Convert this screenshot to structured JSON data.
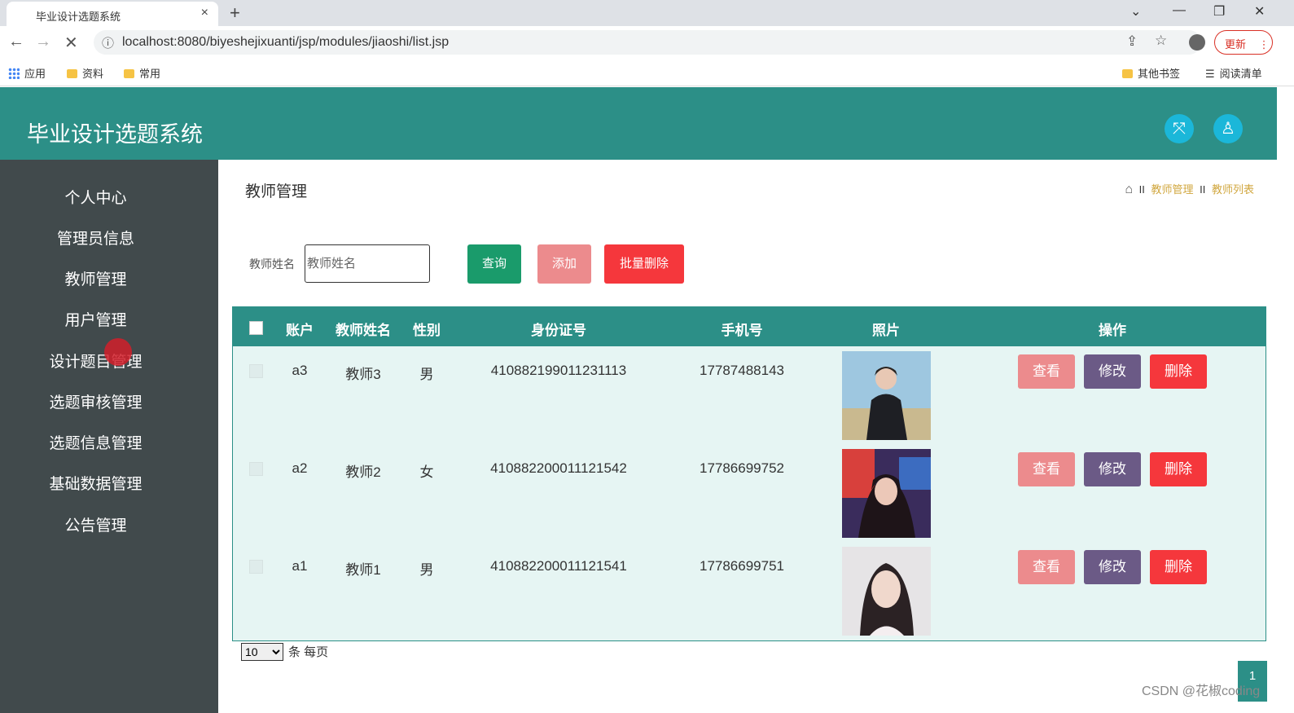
{
  "browser": {
    "tab_title": "毕业设计选题系统",
    "tab_close": "×",
    "new_tab": "+",
    "url": "localhost:8080/biyeshejixuanti/jsp/modules/jiaoshi/list.jsp",
    "update_label": "更新",
    "bookmarks": [
      "应用",
      "资料",
      "常用"
    ],
    "other_bookmarks": "其他书签",
    "reading_list": "阅读清单"
  },
  "app": {
    "title": "毕业设计选题系统"
  },
  "sidebar": {
    "items": [
      {
        "label": "个人中心"
      },
      {
        "label": "管理员信息"
      },
      {
        "label": "教师管理"
      },
      {
        "label": "用户管理"
      },
      {
        "label": "设计题目管理"
      },
      {
        "label": "选题审核管理"
      },
      {
        "label": "选题信息管理"
      },
      {
        "label": "基础数据管理"
      },
      {
        "label": "公告管理"
      }
    ]
  },
  "main": {
    "page_title": "教师管理",
    "breadcrumb": [
      "教师管理",
      "教师列表"
    ],
    "breadcrumb_sep": "II",
    "search": {
      "label": "教师姓名",
      "placeholder": "教师姓名",
      "value": ""
    },
    "buttons": {
      "query": "查询",
      "add": "添加",
      "batch_delete": "批量删除"
    },
    "table": {
      "headers": [
        "账户",
        "教师姓名",
        "性别",
        "身份证号",
        "手机号",
        "照片",
        "操作"
      ],
      "rows": [
        {
          "account": "a3",
          "name": "教师3",
          "gender": "男",
          "id_number": "410882199011231113",
          "phone": "17787488143"
        },
        {
          "account": "a2",
          "name": "教师2",
          "gender": "女",
          "id_number": "410882200011121542",
          "phone": "17786699752"
        },
        {
          "account": "a1",
          "name": "教师1",
          "gender": "男",
          "id_number": "410882200011121541",
          "phone": "17786699751"
        }
      ],
      "actions": {
        "view": "查看",
        "edit": "修改",
        "delete": "删除"
      }
    },
    "pagination": {
      "page_size": "10",
      "suffix": "条 每页",
      "current_page": "1"
    }
  },
  "watermark": "CSDN @花椒coding",
  "colors": {
    "primary": "#2c8f87",
    "sidebar": "#414a4c",
    "query_btn": "#1a9b6b",
    "add_btn": "#ec8b8d",
    "delete_btn": "#f5373c",
    "edit_btn": "#6b5a86",
    "breadcrumb": "#d1a73f"
  }
}
